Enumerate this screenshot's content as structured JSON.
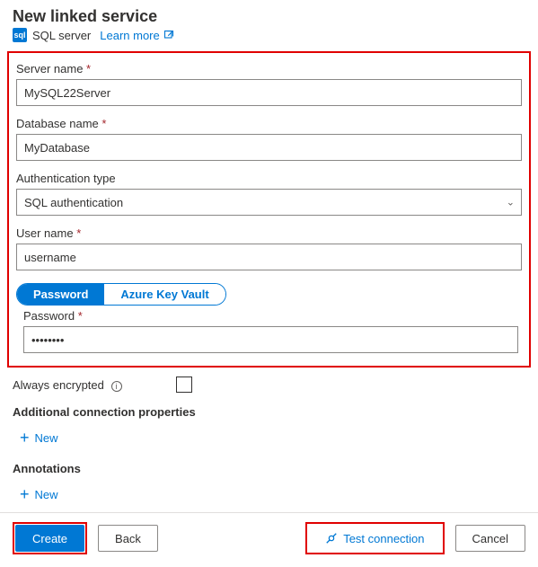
{
  "header": {
    "title": "New linked service",
    "serviceType": "SQL server",
    "learnMore": "Learn more"
  },
  "form": {
    "serverName": {
      "label": "Server name",
      "value": "MySQL22Server",
      "required": true
    },
    "databaseName": {
      "label": "Database name",
      "value": "MyDatabase",
      "required": true
    },
    "authType": {
      "label": "Authentication type",
      "value": "SQL authentication"
    },
    "userName": {
      "label": "User name",
      "value": "username",
      "required": true
    },
    "pwSwitch": {
      "password": "Password",
      "akv": "Azure Key Vault"
    },
    "password": {
      "label": "Password",
      "value": "••••••••",
      "required": true
    }
  },
  "extras": {
    "alwaysEncrypted": "Always encrypted",
    "additionalProps": "Additional connection properties",
    "newLabel": "New",
    "annotations": "Annotations"
  },
  "footer": {
    "create": "Create",
    "back": "Back",
    "testConnection": "Test connection",
    "cancel": "Cancel"
  }
}
